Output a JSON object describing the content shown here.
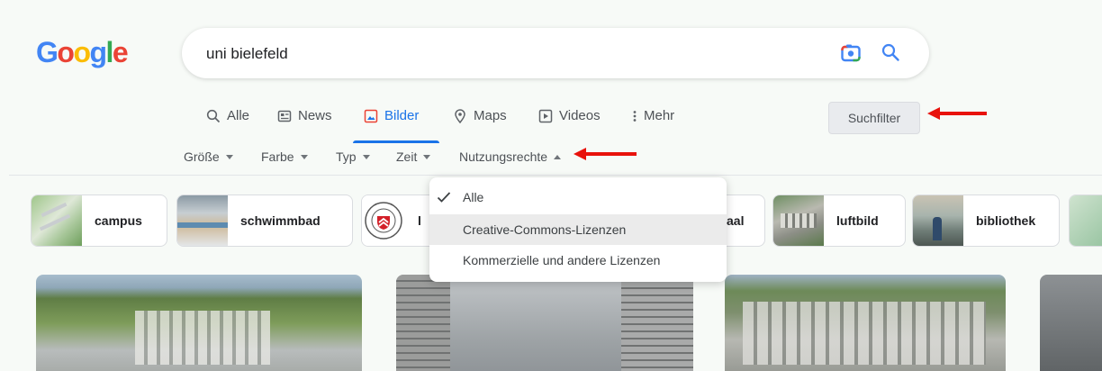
{
  "logo": {
    "letters": [
      "G",
      "o",
      "o",
      "g",
      "l",
      "e"
    ],
    "colors": [
      "#4285f4",
      "#ea4335",
      "#fbbc05",
      "#4285f4",
      "#34a853",
      "#ea4335"
    ]
  },
  "search": {
    "query": "uni bielefeld",
    "camera_icon": "google-lens-icon",
    "search_icon": "search-icon"
  },
  "tabs": [
    {
      "label": "Alle",
      "icon": "search-icon"
    },
    {
      "label": "News",
      "icon": "news-icon"
    },
    {
      "label": "Bilder",
      "icon": "image-icon",
      "active": true
    },
    {
      "label": "Maps",
      "icon": "map-pin-icon"
    },
    {
      "label": "Videos",
      "icon": "play-icon"
    },
    {
      "label": "Mehr",
      "icon": "more-vert-icon"
    }
  ],
  "suchfilter_label": "Suchfilter",
  "filters": [
    {
      "label": "Größe"
    },
    {
      "label": "Farbe"
    },
    {
      "label": "Typ"
    },
    {
      "label": "Zeit"
    },
    {
      "label": "Nutzungsrechte",
      "open": true
    }
  ],
  "chips": [
    {
      "label": "campus"
    },
    {
      "label": "schwimmbad"
    },
    {
      "label": "l"
    },
    {
      "label": "aal"
    },
    {
      "label": "luftbild"
    },
    {
      "label": "bibliothek"
    }
  ],
  "rights_menu": {
    "items": [
      {
        "label": "Alle",
        "selected": true
      },
      {
        "label": "Creative-Commons-Lizenzen",
        "highlighted": true
      },
      {
        "label": "Kommerzielle und andere Lizenzen"
      }
    ]
  },
  "annotation_color": "#e8120c",
  "accent_color": "#1a73e8"
}
